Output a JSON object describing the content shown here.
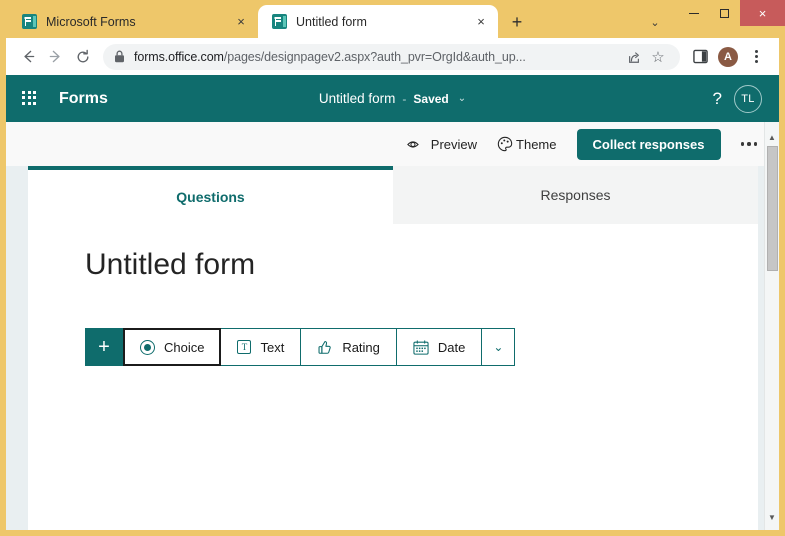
{
  "window": {
    "minimize_label": "minimize",
    "maximize_label": "maximize",
    "close_label": "×",
    "tab_list_label": "⌄"
  },
  "browser": {
    "tabs": [
      {
        "title": "Microsoft Forms",
        "favicon": "forms-favicon",
        "active": false,
        "close_label": "×"
      },
      {
        "title": "Untitled form",
        "favicon": "forms-favicon",
        "active": true,
        "close_label": "×"
      }
    ],
    "new_tab_label": "+",
    "back_label": "←",
    "forward_label": "→",
    "reload_label": "↻",
    "url_host": "forms.office.com",
    "url_path": "/pages/designpagev2.aspx?auth_pvr=OrgId&auth_up...",
    "url_full": "forms.office.com/pages/designpagev2.aspx?auth_pvr=OrgId&auth_up...",
    "share_label": "share-icon",
    "bookmark_label": "☆",
    "sidebar_label": "sidebar-icon",
    "profile_initial": "A",
    "menu_label": "kebab-menu"
  },
  "forms": {
    "brand": "Forms",
    "waffle_label": "app-launcher",
    "title": "Untitled form",
    "title_separator": "-",
    "save_status": "Saved",
    "title_chevron": "⌄",
    "help_label": "?",
    "user_initials": "TL"
  },
  "commandbar": {
    "preview_label": "Preview",
    "theme_label": "Theme",
    "collect_label": "Collect responses",
    "more_label": "more-options"
  },
  "tabs": [
    {
      "label": "Questions",
      "active": true
    },
    {
      "label": "Responses",
      "active": false
    }
  ],
  "canvas": {
    "form_heading": "Untitled form",
    "add_label": "+",
    "question_types": [
      {
        "label": "Choice",
        "icon": "radio-button-icon",
        "selected": true
      },
      {
        "label": "Text",
        "icon": "text-box-icon",
        "selected": false
      },
      {
        "label": "Rating",
        "icon": "thumbs-up-icon",
        "selected": false
      },
      {
        "label": "Date",
        "icon": "calendar-icon",
        "selected": false
      }
    ],
    "more_types_label": "⌄"
  },
  "scrollbar": {
    "up_label": "▲",
    "down_label": "▼"
  },
  "colors": {
    "teal": "#0f6c6c",
    "window_chrome": "#eec76a",
    "close_red": "#c75b5b",
    "page_bg": "#e9eff1",
    "browser_avatar": "#8a5a44"
  }
}
